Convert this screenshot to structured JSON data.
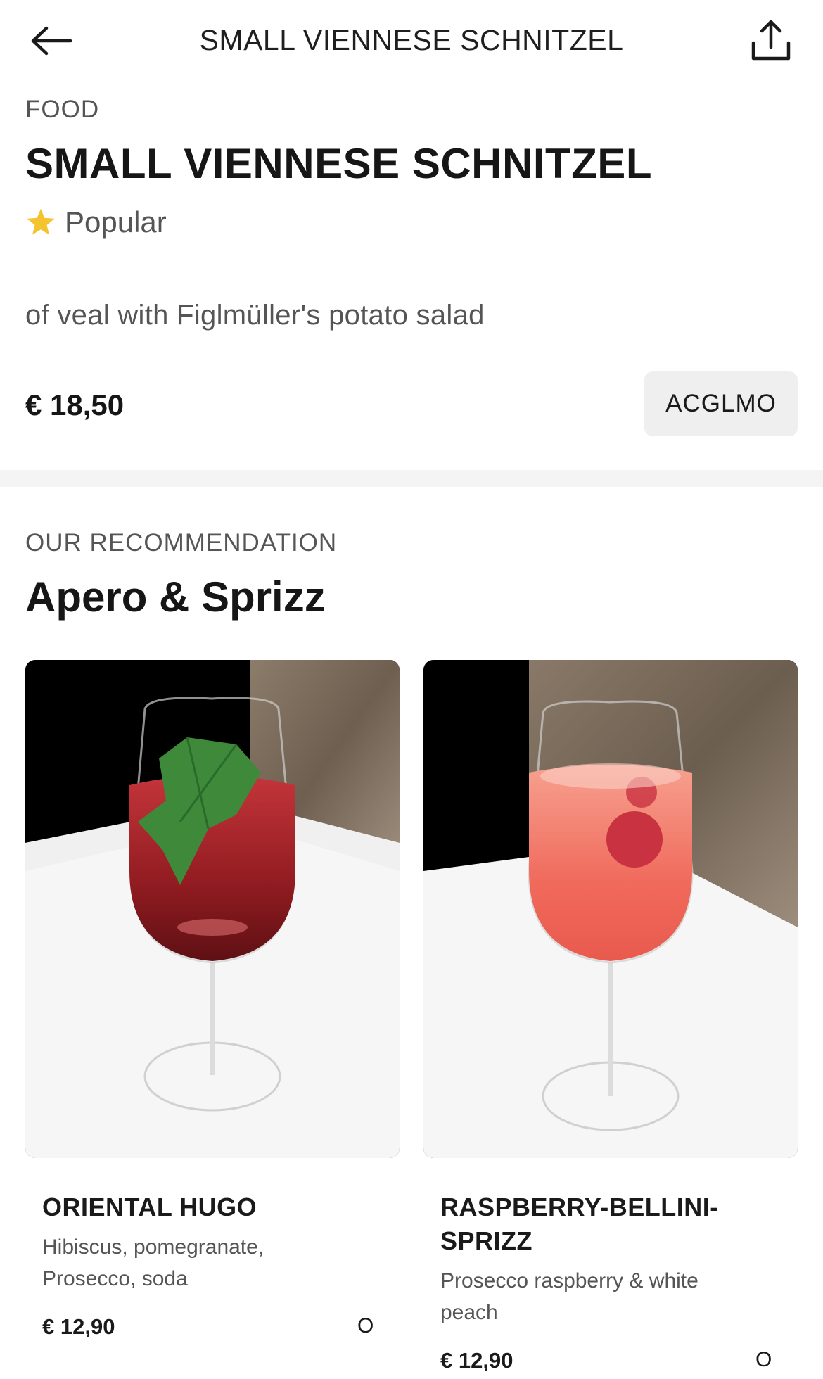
{
  "header": {
    "title": "SMALL VIENNESE SCHNITZEL",
    "back_icon": "arrow-left-icon",
    "share_icon": "share-icon"
  },
  "item": {
    "category": "FOOD",
    "title": "SMALL VIENNESE SCHNITZEL",
    "badge": "Popular",
    "badge_icon": "star-icon",
    "badge_color": "#F4C430",
    "description": "of veal with Figlmüller's potato salad",
    "price": "€ 18,50",
    "allergens": "ACGLMO"
  },
  "recommendation": {
    "label": "OUR RECOMMENDATION",
    "title": "Apero & Sprizz",
    "cards": [
      {
        "name": "ORIENTAL HUGO",
        "description": "Hibiscus, pomegranate, Prosecco, soda",
        "price": "€ 12,90",
        "allergens": "O",
        "drink_color": "#9e1f23"
      },
      {
        "name": "RASPBERRY-BELLINI-SPRIZZ",
        "description": "Prosecco raspberry & white peach",
        "price": "€ 12,90",
        "allergens": "O",
        "drink_color": "#f06a5c"
      }
    ]
  }
}
